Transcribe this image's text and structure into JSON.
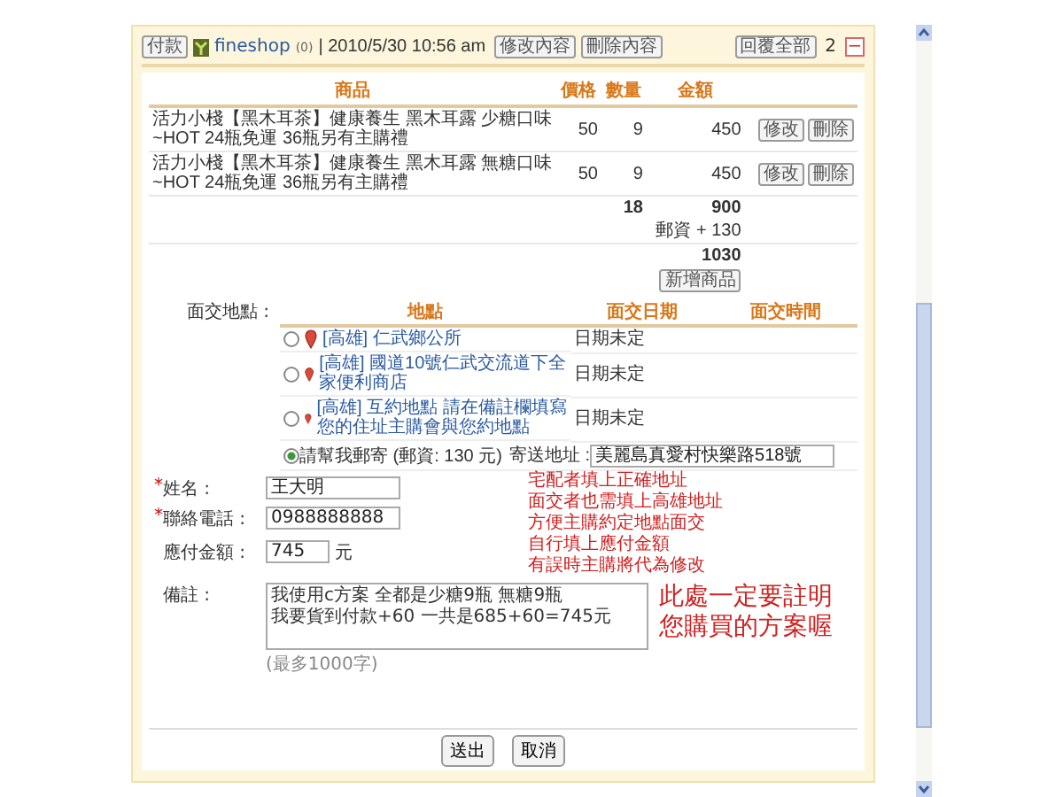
{
  "header": {
    "pay_button": "付款",
    "user": "fineshop",
    "user_count": "(0)",
    "datetime": "| 2010/5/30  10:56 am",
    "buttons": [
      "修改內容",
      "刪除內容"
    ],
    "reply_all": "回覆全部",
    "count": "2",
    "collapse": "−"
  },
  "items_table": {
    "columns": [
      "商品",
      "價格",
      "數量",
      "金額"
    ],
    "rows": [
      {
        "product": [
          "活力小棧【黑木耳茶】健康養生 黑木耳露 少糖口味",
          "~HOT 24瓶免運 36瓶另有主購禮"
        ],
        "price": "50",
        "qty": "9",
        "amount": "450",
        "actions": [
          "修改",
          "刪除"
        ]
      },
      {
        "product": [
          "活力小棧【黑木耳茶】健康養生 黑木耳露 無糖口味",
          "~HOT 24瓶免運 36瓶另有主購禮"
        ],
        "price": "50",
        "qty": "9",
        "amount": "450",
        "actions": [
          "修改",
          "刪除"
        ]
      }
    ],
    "total_qty": "18",
    "subtotal": "900",
    "shipping_label": "郵資",
    "shipping": "+ 130",
    "total": "1030",
    "add_button": "新增商品"
  },
  "meeting": {
    "label": "面交地點 :",
    "columns": [
      "地點",
      "面交日期",
      "面交時間"
    ],
    "options": [
      {
        "kind": "location",
        "selected": false,
        "place": "[高雄] 仁武鄉公所",
        "date": "日期未定"
      },
      {
        "kind": "location",
        "selected": false,
        "place": "[高雄] 國道10號仁武交流道下全家便利商店",
        "date": "日期未定"
      },
      {
        "kind": "location",
        "selected": false,
        "place": "[高雄] 互約地點 請在備註欄填寫您的住址主購會與您約地點",
        "date": "日期未定"
      },
      {
        "kind": "mail",
        "selected": true,
        "text": "請幫我郵寄 (郵資: 130 元)",
        "address_label": "寄送地址 :",
        "address": "美麗島真愛村快樂路518號"
      }
    ]
  },
  "form": {
    "groups": [
      {
        "fields": [
          {
            "kind": "text",
            "mark": "*",
            "label": "姓名 :",
            "value": "王大明"
          },
          {
            "kind": "text",
            "mark": "*",
            "label": "聯絡電話 :",
            "value": "0988888888"
          }
        ],
        "note": [
          "宅配者填上正確地址",
          "面交者也需填上高雄地址",
          "方便主購約定地點面交"
        ],
        "emphasis": false
      },
      {
        "fields": [
          {
            "kind": "short",
            "label": "應付金額 :",
            "value": "745",
            "unit": "元"
          }
        ],
        "note": [
          "自行填上應付金額",
          "有誤時主購將代為修改"
        ],
        "emphasis": false
      },
      {
        "fields": [
          {
            "kind": "textarea",
            "label": "備註 :",
            "value": [
              "我使用c方案 全都是少糖9瓶 無糖9瓶",
              "我要貨到付款+60 一共是685+60=745元"
            ],
            "hint": "(最多1000字)"
          }
        ],
        "note": [
          "此處一定要註明",
          "您購買的方案喔"
        ],
        "emphasis": true
      }
    ]
  },
  "buttons": [
    "送出",
    "取消"
  ]
}
